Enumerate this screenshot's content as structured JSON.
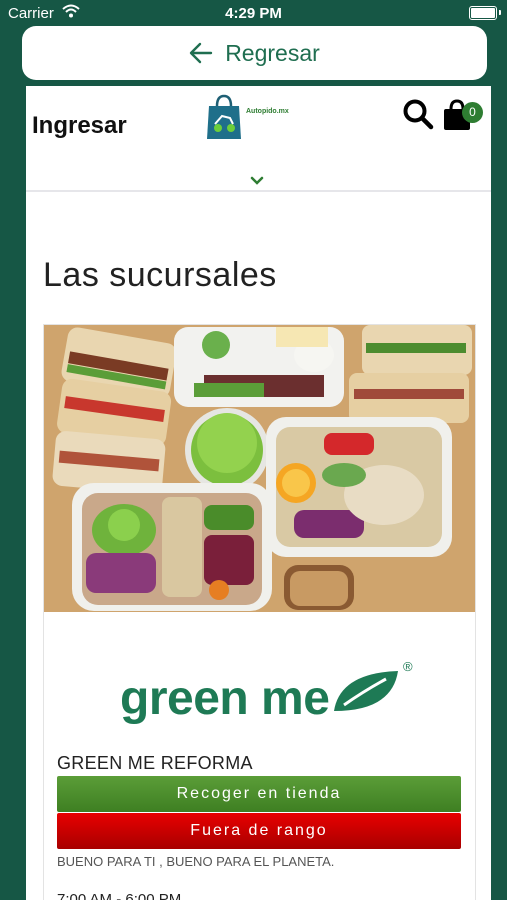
{
  "status_bar": {
    "carrier": "Carrier",
    "time": "4:29 PM"
  },
  "nav": {
    "back_label": "Regresar"
  },
  "header": {
    "login_label": "Ingresar",
    "logo_text": "Autopido.mx",
    "cart_count": "0"
  },
  "page": {
    "title": "Las sucursales"
  },
  "store": {
    "brand": "green me",
    "brand_mark": "®",
    "name": "GREEN ME REFORMA",
    "pickup_label": "Recoger en tienda",
    "range_label": "Fuera de rango",
    "slogan": "BUENO PARA TI , BUENO PARA EL PLANETA.",
    "hours": "7:00 AM - 6:00 PM"
  },
  "colors": {
    "background": "#165745",
    "accent": "#1e7a55",
    "pickup_button": "#4a8c2a",
    "range_button": "#d40000"
  }
}
